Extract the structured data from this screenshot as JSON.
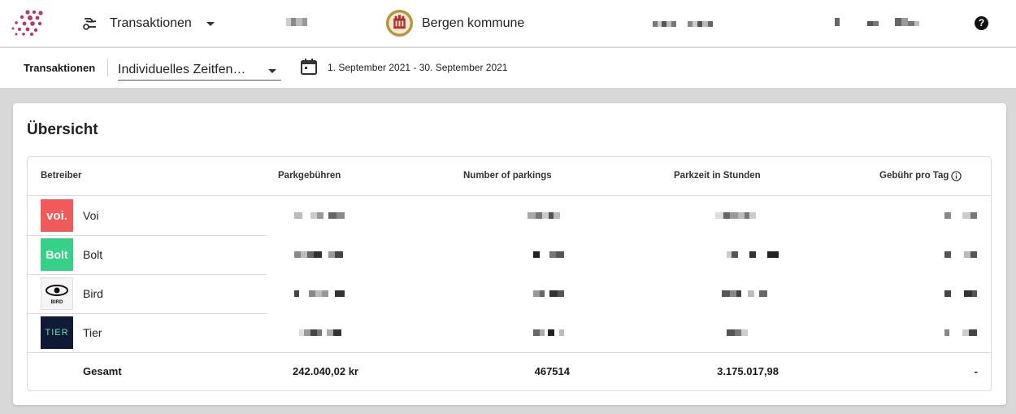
{
  "header": {
    "nav_label": "Transaktionen",
    "city_name": "Bergen kommune",
    "help_label": "?"
  },
  "filter": {
    "title": "Transaktionen",
    "period_select": "Individuelles Zeitfen…",
    "date_range": "1. September 2021 - 30. September 2021"
  },
  "overview": {
    "title": "Übersicht",
    "columns": [
      "Betreiber",
      "Parkgebühren",
      "Number of parkings",
      "Parkzeit in Stunden",
      "Gebühr pro Tag"
    ],
    "operators": [
      {
        "name": "Voi",
        "logo_text": "voi.",
        "logo_color": "#f25a5a"
      },
      {
        "name": "Bolt",
        "logo_text": "Bolt",
        "logo_color": "#34d186"
      },
      {
        "name": "Bird",
        "logo_text": "BIRD",
        "logo_color": "#f5f5f5"
      },
      {
        "name": "Tier",
        "logo_text": "TIER",
        "logo_color": "#0e1a36"
      }
    ],
    "totals": {
      "label": "Gesamt",
      "fees": "242.040,02 kr",
      "parkings": "467514",
      "hours": "3.175.017,98",
      "fee_per_day": "-"
    }
  },
  "icons": {
    "nav": "scooter-icon",
    "calendar": "calendar-icon",
    "info": "info-icon",
    "help": "help-icon"
  }
}
